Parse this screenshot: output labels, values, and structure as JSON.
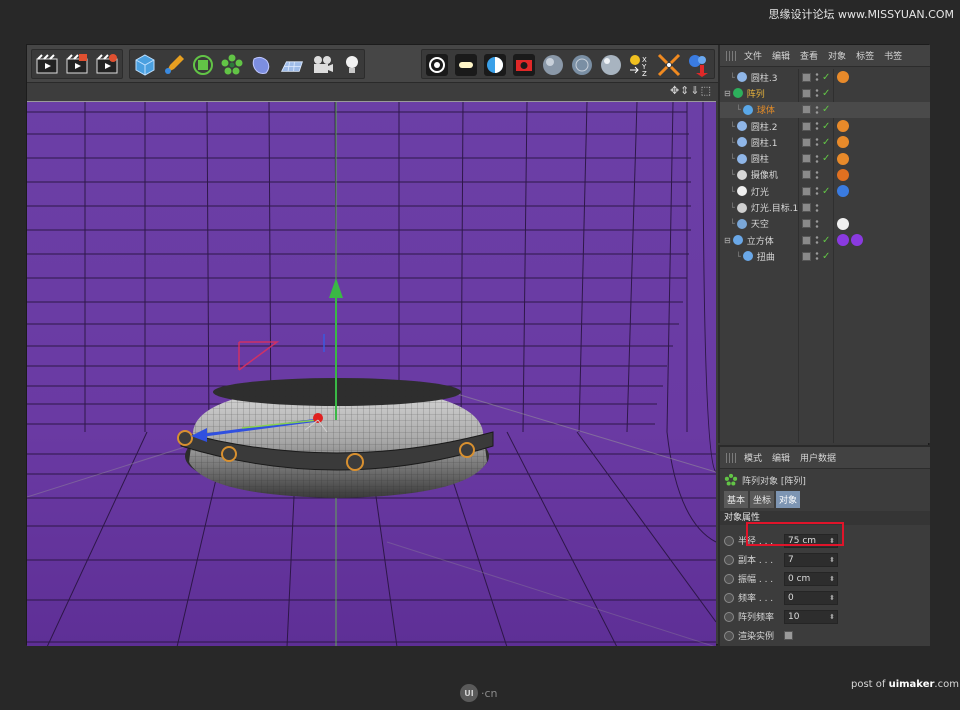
{
  "watermark": {
    "top_right": "思缘设计论坛 www.MISSYUAN.COM"
  },
  "toolbar": {
    "buttons": [
      "render-view-icon",
      "render-picture-viewer-icon",
      "render-settings-icon",
      "cube-icon",
      "pen-icon",
      "subdivision-icon",
      "array-icon",
      "deformer-icon",
      "floor-icon",
      "camera-icon",
      "light-icon",
      "display-gouraud-icon",
      "display-quick-icon",
      "display-constant-icon",
      "snap-icon",
      "material-sphere-icon",
      "material-sphere-2-icon",
      "material-sphere-3-icon",
      "xyz-axis-icon",
      "move-axis-icon",
      "scene-move-icon"
    ]
  },
  "viewport": {
    "nav_icons": "✥⇕⇓⬚"
  },
  "object_manager": {
    "menu": [
      "文件",
      "编辑",
      "查看",
      "对象",
      "标签",
      "书签"
    ],
    "rows": [
      {
        "name": "圆柱.3",
        "indent": 1,
        "icon_color": "#8fb6e8",
        "check": true,
        "tags": [
          "#e88a2a"
        ]
      },
      {
        "name": "阵列",
        "indent": 0,
        "icon_color": "#2db05c",
        "check": true,
        "tags": [],
        "name_color": "#e8b43c",
        "expand": true
      },
      {
        "name": "球体",
        "indent": 2,
        "icon_color": "#5aa8e8",
        "check": true,
        "tags": [],
        "name_color": "#e08a28",
        "selected": true
      },
      {
        "name": "圆柱.2",
        "indent": 1,
        "icon_color": "#8fb6e8",
        "check": true,
        "tags": [
          "#e88a2a"
        ]
      },
      {
        "name": "圆柱.1",
        "indent": 1,
        "icon_color": "#8fb6e8",
        "check": true,
        "tags": [
          "#e88a2a"
        ]
      },
      {
        "name": "圆柱",
        "indent": 1,
        "icon_color": "#8fb6e8",
        "check": true,
        "tags": [
          "#e88a2a"
        ]
      },
      {
        "name": "摄像机",
        "indent": 1,
        "icon_color": "#d8d8d8",
        "check": false,
        "tags": [
          "#e07020"
        ]
      },
      {
        "name": "灯光",
        "indent": 1,
        "icon_color": "#f0f0f0",
        "check": true,
        "tags": [
          "#3a7be0"
        ]
      },
      {
        "name": "灯光.目标.1",
        "indent": 1,
        "icon_color": "#d0d0d0",
        "check": false,
        "tags": []
      },
      {
        "name": "天空",
        "indent": 1,
        "icon_color": "#7aa7d8",
        "check": false,
        "tags": [
          "#f0f0f0"
        ]
      },
      {
        "name": "立方体",
        "indent": 0,
        "icon_color": "#6aa8e8",
        "check": true,
        "tags": [
          "#8a3ae0",
          "#8a3ae0"
        ],
        "expand": true
      },
      {
        "name": "扭曲",
        "indent": 2,
        "icon_color": "#6aa8e8",
        "check": true,
        "tags": []
      }
    ]
  },
  "attribute_manager": {
    "menu": [
      "模式",
      "编辑",
      "用户数据"
    ],
    "title": "阵列对象 [阵列]",
    "tabs": [
      {
        "label": "基本",
        "active": false
      },
      {
        "label": "坐标",
        "active": false
      },
      {
        "label": "对象",
        "active": true
      }
    ],
    "section": "对象属性",
    "fields": [
      {
        "label": "半径 . . .",
        "value": "75 cm",
        "kind": "input"
      },
      {
        "label": "副本 . . .",
        "value": "7",
        "kind": "input"
      },
      {
        "label": "振幅 . . .",
        "value": "0 cm",
        "kind": "input"
      },
      {
        "label": "频率 . . .",
        "value": "0",
        "kind": "input"
      },
      {
        "label": "阵列频率",
        "value": "10",
        "kind": "input"
      },
      {
        "label": "渲染实例",
        "value": "",
        "kind": "checkbox"
      }
    ]
  },
  "footer": {
    "logo_disc": "UI",
    "logo_text": "·cn",
    "post_prefix": "post of ",
    "post_site": "uimaker",
    "post_suffix": ".com"
  },
  "colors": {
    "viewport_bg": "#6b3fa3",
    "highlight": "#e0142a",
    "check": "#62c446"
  }
}
